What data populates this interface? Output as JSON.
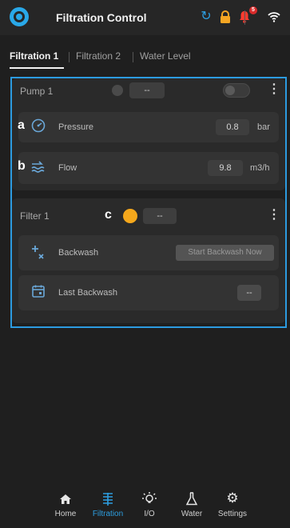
{
  "app": {
    "title": "Filtration Control"
  },
  "header": {
    "icons": {
      "sync": "sync-icon",
      "lock": "lock-icon",
      "bell": "bell-icon",
      "wifi": "wifi-icon"
    },
    "notification_count": "5",
    "colors": {
      "sync": "#2d9ee0",
      "lock": "#f5a623",
      "bell": "#ff3b2f",
      "accent": "#2c9be0"
    }
  },
  "tabs": [
    {
      "label": "Filtration 1",
      "active": true
    },
    {
      "label": "Filtration 2",
      "active": false
    },
    {
      "label": "Water Level",
      "active": false
    }
  ],
  "markers": {
    "a": "a",
    "b": "b",
    "c": "c"
  },
  "pump": {
    "title": "Pump 1",
    "mode_value": "--",
    "status_color": "#4a4a4a",
    "toggle_on": false,
    "rows": [
      {
        "label": "Pressure",
        "value": "0.8",
        "unit": "bar",
        "icon": "gauge-icon"
      },
      {
        "label": "Flow",
        "value": "9.8",
        "unit": "m3/h",
        "icon": "flow-icon"
      }
    ]
  },
  "filter": {
    "title": "Filter 1",
    "mode_value": "--",
    "status_color": "#f5a81c",
    "rows": [
      {
        "label": "Backwash",
        "action": "Start Backwash Now",
        "icon": "backwash-icon"
      },
      {
        "label": "Last Backwash",
        "value": "--",
        "icon": "calendar-icon"
      }
    ]
  },
  "nav": {
    "items": [
      {
        "label": "Home",
        "icon": "home-icon",
        "active": false
      },
      {
        "label": "Filtration",
        "icon": "filtration-icon",
        "active": true
      },
      {
        "label": "I/O",
        "icon": "bulb-icon",
        "active": false
      },
      {
        "label": "Water",
        "icon": "flask-icon",
        "active": false
      },
      {
        "label": "Settings",
        "icon": "gear-icon",
        "active": false
      }
    ]
  }
}
